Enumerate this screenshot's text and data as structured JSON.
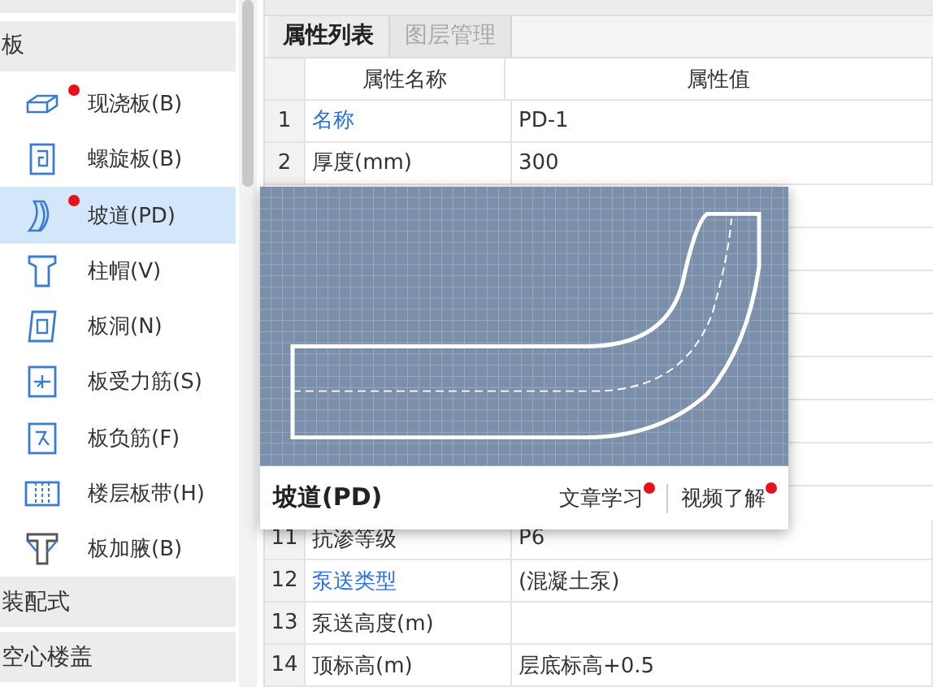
{
  "sidebar": {
    "groups": [
      {
        "label": "板",
        "expanded": true,
        "items": [
          {
            "label": "现浇板(B)",
            "new": true,
            "selected": false
          },
          {
            "label": "螺旋板(B)",
            "new": false,
            "selected": false
          },
          {
            "label": "坡道(PD)",
            "new": true,
            "selected": true
          },
          {
            "label": "柱帽(V)",
            "new": false,
            "selected": false
          },
          {
            "label": "板洞(N)",
            "new": false,
            "selected": false
          },
          {
            "label": "板受力筋(S)",
            "new": false,
            "selected": false
          },
          {
            "label": "板负筋(F)",
            "new": false,
            "selected": false
          },
          {
            "label": "楼层板带(H)",
            "new": false,
            "selected": false
          },
          {
            "label": "板加腋(B)",
            "new": false,
            "selected": false
          }
        ]
      },
      {
        "label": "装配式",
        "expanded": false
      },
      {
        "label": "空心楼盖",
        "expanded": false
      }
    ]
  },
  "tabs": [
    {
      "label": "属性列表",
      "selected": true
    },
    {
      "label": "图层管理",
      "selected": false
    }
  ],
  "table": {
    "columns": [
      "属性名称",
      "属性值"
    ],
    "rows_top": [
      {
        "number": "1",
        "name": "名称",
        "link": true,
        "value": "PD-1"
      },
      {
        "number": "2",
        "name": "厚度(mm)",
        "link": false,
        "value": "300"
      }
    ],
    "rows_bottom": [
      {
        "number": "11",
        "name": "抗渗等级",
        "link": false,
        "value": "P6"
      },
      {
        "number": "12",
        "name": "泵送类型",
        "link": true,
        "value": "(混凝土泵)"
      },
      {
        "number": "13",
        "name": "泵送高度(m)",
        "link": false
      },
      {
        "number": "14",
        "name": "顶标高(m)",
        "link": false,
        "value": "层底标高+0.5"
      }
    ]
  },
  "popup": {
    "title": "坡道(PD)",
    "links": [
      {
        "label": "文章学习",
        "new": true
      },
      {
        "label": "视频了解",
        "new": true
      }
    ]
  }
}
